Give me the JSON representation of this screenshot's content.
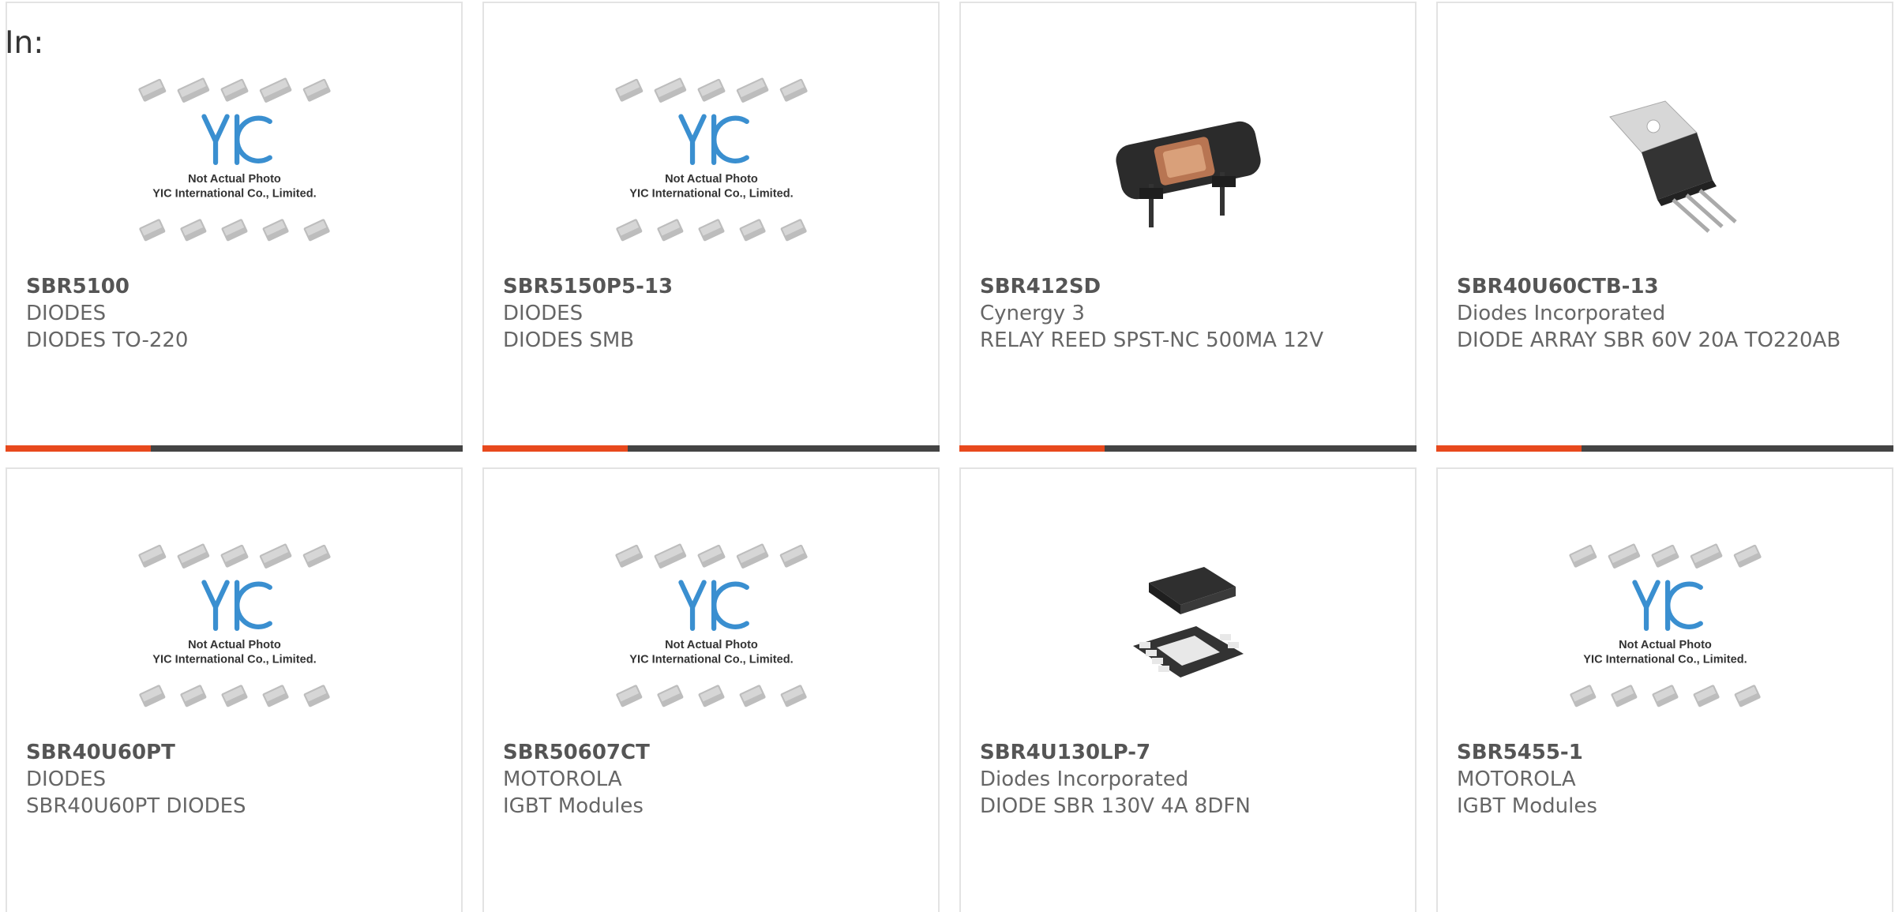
{
  "heading": "In:",
  "colors": {
    "accent": "#e8491d",
    "bar": "#444444",
    "border": "#e3e3e3",
    "text": "#666666"
  },
  "placeholder": {
    "caption1": "Not Actual Photo",
    "caption2": "YIC International Co., Limited.",
    "logo": "YIC"
  },
  "products": [
    {
      "part": "SBR5100",
      "maker": "DIODES",
      "desc": "DIODES TO-220",
      "image": "placeholder"
    },
    {
      "part": "SBR5150P5-13",
      "maker": "DIODES",
      "desc": "DIODES SMB",
      "image": "placeholder"
    },
    {
      "part": "SBR412SD",
      "maker": "Cynergy 3",
      "desc": "RELAY REED SPST-NC 500MA 12V",
      "image": "relay"
    },
    {
      "part": "SBR40U60CTB-13",
      "maker": "Diodes Incorporated",
      "desc": "DIODE ARRAY SBR 60V 20A TO220AB",
      "image": "to220"
    },
    {
      "part": "SBR40U60PT",
      "maker": "DIODES",
      "desc": "SBR40U60PT DIODES",
      "image": "placeholder"
    },
    {
      "part": "SBR50607CT",
      "maker": "MOTOROLA",
      "desc": "IGBT Modules",
      "image": "placeholder"
    },
    {
      "part": "SBR4U130LP-7",
      "maker": "Diodes Incorporated",
      "desc": "DIODE SBR 130V 4A 8DFN",
      "image": "dfn"
    },
    {
      "part": "SBR5455-1",
      "maker": "MOTOROLA",
      "desc": "IGBT Modules",
      "image": "placeholder"
    }
  ]
}
